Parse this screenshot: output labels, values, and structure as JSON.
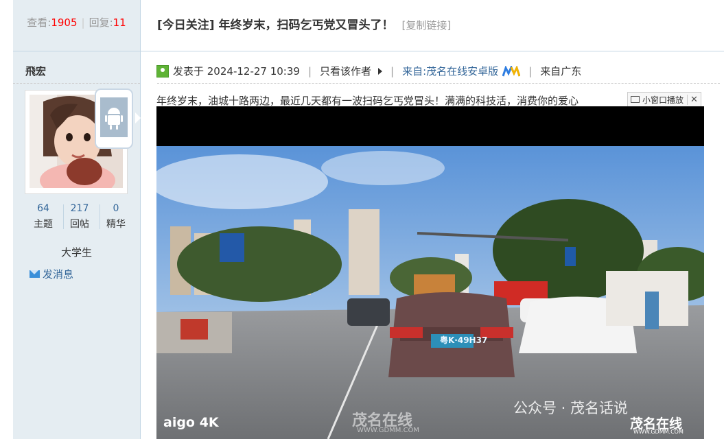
{
  "thread_stats": {
    "views_label": "查看:",
    "views": "1905",
    "replies_label": "回复:",
    "replies": "11"
  },
  "thread": {
    "title": "[今日关注] 年终岁末，扫码乞丐党又冒头了！",
    "copy_link": "[复制链接]"
  },
  "author": {
    "name": "飛宏",
    "counts": [
      {
        "value": "64",
        "label": "主题"
      },
      {
        "value": "217",
        "label": "回帖"
      },
      {
        "value": "0",
        "label": "精华"
      }
    ],
    "rank": "大学生",
    "send_message": "发消息"
  },
  "post": {
    "posted_at": "发表于 2024-12-27 10:39",
    "only_author": "只看该作者",
    "source": "来自:茂名在线安卓版",
    "location": "来自广东",
    "text": "年终岁末，油城十路两边，最近几天都有一波扫码乞丐党冒头！满满的科技活，消费你的爱心",
    "mini_window": "小窗口播放",
    "close": "✕"
  },
  "video": {
    "plate": "粤K·49H37",
    "watermark_camera": "aigo 4K",
    "watermark_site": "茂名在线",
    "watermark_site_url": "WWW.GDMM.COM",
    "watermark_wechat": "公众号 · 茂名话说",
    "watermark_corner": "茂名在线",
    "watermark_corner_url": "WWW.GDMM.COM"
  },
  "colors": {
    "accent_link": "#336699",
    "stat_number": "#ff0000",
    "sidebar_bg": "#e5edf2",
    "border": "#c2d5e3"
  }
}
